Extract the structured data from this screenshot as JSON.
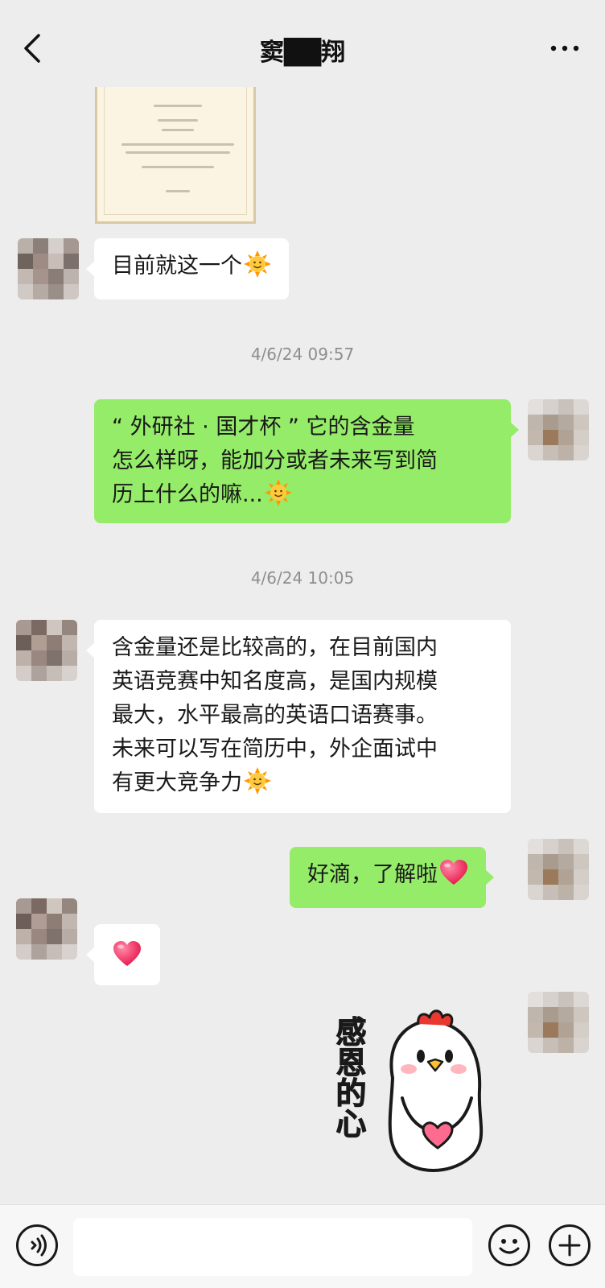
{
  "header": {
    "title": "窦██翔",
    "back_icon": "chevron-left-icon",
    "more_icon": "more-dots-icon"
  },
  "messages": [
    {
      "side": "left",
      "text": "目前就这一个",
      "emoji": "sun-emoji"
    },
    {
      "type": "timestamp",
      "text": "4/6/24 09:57"
    },
    {
      "side": "right",
      "lines": [
        "“ 外研社 · 国才杯 ” 它的含金量",
        "怎么样呀，能加分或者未来写到简",
        "历上什么的嘛..."
      ],
      "emoji": "sun-emoji"
    },
    {
      "type": "timestamp",
      "text": "4/6/24 10:05"
    },
    {
      "side": "left",
      "lines": [
        "含金量还是比较高的，在目前国内",
        "英语竞赛中知名度高，是国内规模",
        "最大，水平最高的英语口语赛事。",
        "未来可以写在简历中，外企面试中",
        "有更大竞争力"
      ],
      "emoji": "sun-emoji"
    },
    {
      "side": "right",
      "text": "好滴，了解啦",
      "emoji": "heart-emoji"
    },
    {
      "side": "left",
      "text": "",
      "emoji": "heart-emoji"
    },
    {
      "side": "right",
      "type": "sticker",
      "sticker_text": "感恩的心",
      "icon": "chick-heart-sticker"
    }
  ],
  "colors": {
    "background": "#ededed",
    "bubble_left": "#ffffff",
    "bubble_right": "#95ec69",
    "timestamp": "#8e8e8e"
  },
  "bottom_bar": {
    "voice_icon": "voice-icon",
    "input_value": "",
    "emoji_icon": "smiley-icon",
    "plus_icon": "plus-icon"
  }
}
